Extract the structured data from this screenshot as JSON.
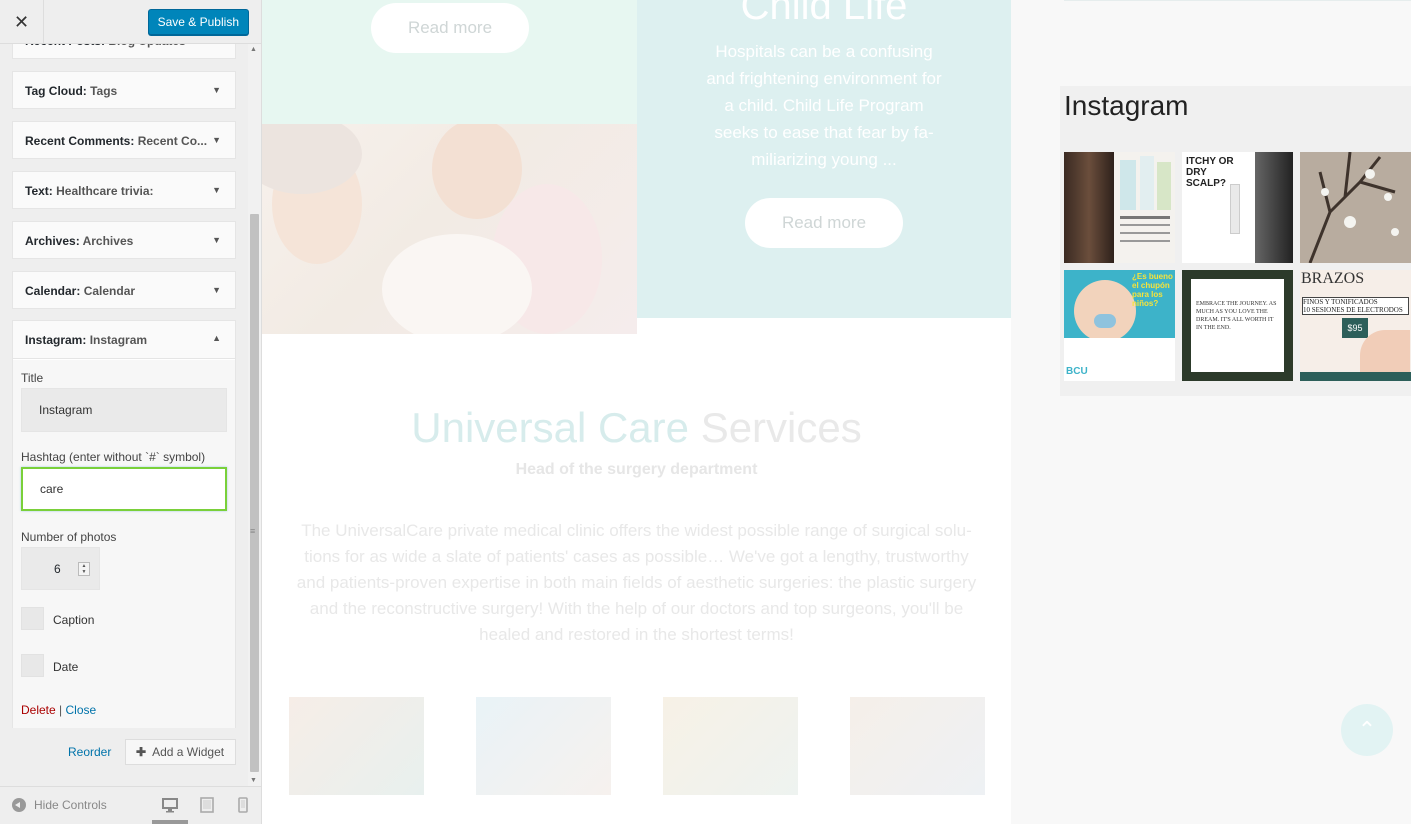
{
  "header": {
    "close_glyph": "✕",
    "save_label": "Save & Publish"
  },
  "widgets": [
    {
      "type": "Recent Posts:",
      "name": "Blog Updates"
    },
    {
      "type": "Tag Cloud:",
      "name": "Tags"
    },
    {
      "type": "Recent Comments:",
      "name": "Recent Co..."
    },
    {
      "type": "Text:",
      "name": "Healthcare trivia:"
    },
    {
      "type": "Archives:",
      "name": "Archives"
    },
    {
      "type": "Calendar:",
      "name": "Calendar"
    }
  ],
  "instagram_widget": {
    "type": "Instagram:",
    "name": "Instagram",
    "title_label": "Title",
    "title_value": "Instagram",
    "hashtag_label": "Hashtag (enter without `#` symbol)",
    "hashtag_value": "care",
    "photos_label": "Number of photos",
    "photos_value": "6",
    "caption_label": "Caption",
    "date_label": "Date",
    "delete_label": "Delete",
    "separator": "|",
    "close_label": "Close"
  },
  "section_actions": {
    "reorder_label": "Reorder",
    "add_widget_label": "Add a Widget"
  },
  "footer": {
    "hide_controls_label": "Hide Controls",
    "devices": [
      "desktop-icon",
      "tablet-icon",
      "mobile-icon"
    ]
  },
  "preview": {
    "read_more_1": "Read more",
    "read_more_2": "Read more",
    "child_title": "Child Life",
    "child_text": "Hospitals can be a confusing and frightening environment for a child. Child Life Program seeks to ease that fear by fa-miliarizing young ...",
    "instagram_title": "Instagram",
    "thumb_texts": {
      "t2": "ITCHY OR DRY SCALP?",
      "t4": "¿Es bueno el chupón para los niños?",
      "t4b": "BCU",
      "t5": "EMBRACE THE JOURNEY. AS MUCH AS YOU LOVE THE DREAM. IT'S ALL WORTH IT IN THE END.",
      "t6a": "BRAZOS",
      "t6b": "FINOS Y TONIFICADOS",
      "t6c": "10 SESIONES DE ELECTRODOS",
      "t6d": "$95"
    },
    "services_title_a": "Universal Care",
    "services_title_b": "Services",
    "services_sub": "Head of the surgery department",
    "services_body": "The UniversalCare private medical clinic offers the widest possible range of surgical solu-tions for as wide a slate of patients' cases as possible… We've got a lengthy, trustworthy and patients-proven expertise in both main fields of aesthetic surgeries: the plastic surgery and the reconstructive surgery! With the help of our doctors and top surgeons, you'll be healed and restored in the shortest terms!",
    "up_glyph": "⌃"
  },
  "colors": {
    "accent": "#0085ba",
    "focus": "#7ad03a",
    "teal": "#ddf0f0",
    "mint": "#e7f7f1"
  }
}
